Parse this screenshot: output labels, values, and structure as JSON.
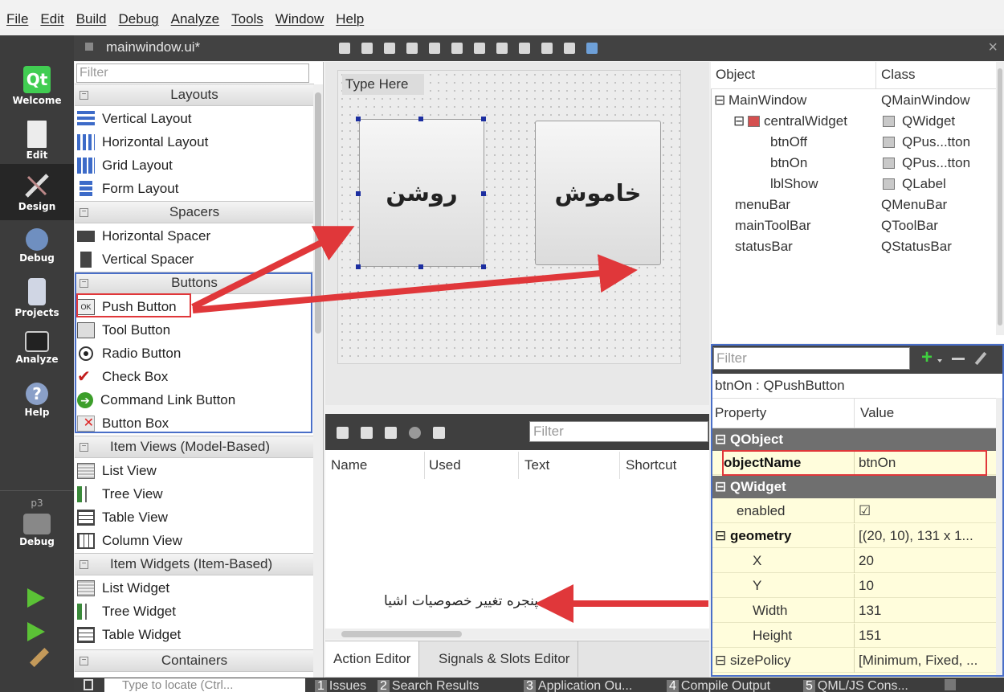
{
  "menubar": {
    "items": [
      "File",
      "Edit",
      "Build",
      "Debug",
      "Analyze",
      "Tools",
      "Window",
      "Help"
    ]
  },
  "modes": [
    {
      "label": "Welcome",
      "icon": "qt-logo-icon"
    },
    {
      "label": "Edit",
      "icon": "document-icon"
    },
    {
      "label": "Design",
      "icon": "pen-ruler-icon",
      "active": true
    },
    {
      "label": "Debug",
      "icon": "bug-icon"
    },
    {
      "label": "Projects",
      "icon": "folder-icon"
    },
    {
      "label": "Analyze",
      "icon": "monitor-icon"
    },
    {
      "label": "Help",
      "icon": "help-icon"
    }
  ],
  "kit": {
    "name": "p3",
    "mode": "Debug"
  },
  "document": {
    "title": "mainwindow.ui*"
  },
  "widget_box": {
    "filter_placeholder": "Filter",
    "categories": {
      "layouts": "Layouts",
      "spacers": "Spacers",
      "buttons": "Buttons",
      "item_views": "Item Views (Model-Based)",
      "item_widgets": "Item Widgets (Item-Based)",
      "containers": "Containers"
    },
    "layouts": [
      "Vertical Layout",
      "Horizontal Layout",
      "Grid Layout",
      "Form Layout"
    ],
    "spacers": [
      "Horizontal Spacer",
      "Vertical Spacer"
    ],
    "buttons": [
      "Push Button",
      "Tool Button",
      "Radio Button",
      "Check Box",
      "Command Link Button",
      "Button Box"
    ],
    "item_views": [
      "List View",
      "Tree View",
      "Table View",
      "Column View"
    ],
    "item_widgets": [
      "List Widget",
      "Tree Widget",
      "Table Widget"
    ]
  },
  "form": {
    "type_here": "Type Here",
    "btn_on_text": "روشن",
    "btn_off_text": "خاموش"
  },
  "action_editor": {
    "filter_placeholder": "Filter",
    "columns": [
      "Name",
      "Used",
      "Text",
      "Shortcut"
    ],
    "tabs": [
      "Action Editor",
      "Signals & Slots Editor"
    ]
  },
  "object_inspector": {
    "columns": [
      "Object",
      "Class"
    ],
    "rows": [
      {
        "object": "MainWindow",
        "class": "QMainWindow",
        "depth": 0,
        "expander": "⊟"
      },
      {
        "object": "centralWidget",
        "class": "QWidget",
        "depth": 1,
        "expander": "⊟"
      },
      {
        "object": "btnOff",
        "class": "QPus...tton",
        "depth": 2,
        "expander": ""
      },
      {
        "object": "btnOn",
        "class": "QPus...tton",
        "depth": 2,
        "expander": ""
      },
      {
        "object": "lblShow",
        "class": "QLabel",
        "depth": 2,
        "expander": ""
      },
      {
        "object": "menuBar",
        "class": "QMenuBar",
        "depth": 1,
        "expander": ""
      },
      {
        "object": "mainToolBar",
        "class": "QToolBar",
        "depth": 1,
        "expander": ""
      },
      {
        "object": "statusBar",
        "class": "QStatusBar",
        "depth": 1,
        "expander": ""
      }
    ]
  },
  "property_editor": {
    "filter_placeholder": "Filter",
    "selected": "btnOn : QPushButton",
    "columns": [
      "Property",
      "Value"
    ],
    "groups": {
      "qobject": "QObject",
      "qwidget": "QWidget"
    },
    "rows": {
      "objectName": {
        "key": "objectName",
        "value": "btnOn"
      },
      "enabled": {
        "key": "enabled",
        "value": "☑"
      },
      "geometry": {
        "key": "geometry",
        "value": "[(20, 10), 131 x 1..."
      },
      "x": {
        "key": "X",
        "value": "20"
      },
      "y": {
        "key": "Y",
        "value": "10"
      },
      "width": {
        "key": "Width",
        "value": "131"
      },
      "height": {
        "key": "Height",
        "value": "151"
      },
      "sizePolicy": {
        "key": "sizePolicy",
        "value": "[Minimum, Fixed, ..."
      }
    }
  },
  "annotation": {
    "text": "پنجره تغییر خصوصیات اشیا"
  },
  "status_bar": {
    "locate_placeholder": "Type to locate (Ctrl...",
    "tabs": [
      {
        "num": "1",
        "label": "Issues"
      },
      {
        "num": "2",
        "label": "Search Results"
      },
      {
        "num": "3",
        "label": "Application Ou..."
      },
      {
        "num": "4",
        "label": "Compile Output"
      },
      {
        "num": "5",
        "label": "QML/JS Cons..."
      }
    ]
  },
  "colors": {
    "annotation_red": "#e0373a",
    "annotation_blue": "#4a6fc8",
    "property_bg": "#fffddc"
  }
}
